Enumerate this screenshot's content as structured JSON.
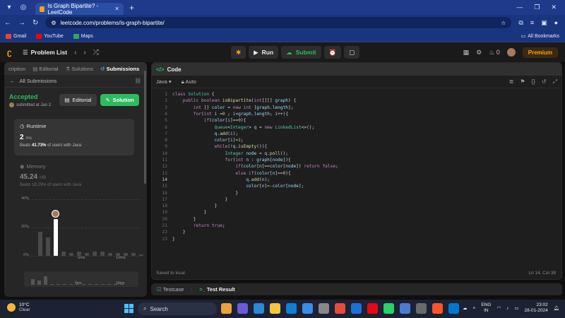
{
  "browser": {
    "tab_title": "Is Graph Bipartite? - LeetCode",
    "url": "leetcode.com/problems/is-graph-bipartite/",
    "bookmarks": [
      {
        "label": "Gmail",
        "color": "#ea4335"
      },
      {
        "label": "YouTube",
        "color": "#ff0000"
      },
      {
        "label": "Maps",
        "color": "#34a853"
      }
    ],
    "all_bookmarks": "All Bookmarks"
  },
  "lc": {
    "problem_list": "Problem List",
    "run": "Run",
    "submit": "Submit",
    "fire_count": "0",
    "premium": "Premium"
  },
  "left": {
    "tabs": [
      "cription",
      "Editorial",
      "Solutions",
      "Submissions"
    ],
    "all_submissions": "All Submissions",
    "accepted": "Accepted",
    "submitted": "submitted at Jan 2",
    "editorial_btn": "Editorial",
    "solution_btn": "Solution",
    "runtime_title": "Runtime",
    "runtime_value": "2",
    "runtime_unit": "ms",
    "runtime_beats_pre": "Beats ",
    "runtime_beats_pct": "41.73%",
    "runtime_beats_post": " of users with Java",
    "memory_title": "Memory",
    "memory_value": "45.24",
    "memory_unit": "MB",
    "memory_beats": "Beats 18.29% of users with Java",
    "hist_y": [
      "40%",
      "20%",
      "0%"
    ],
    "hist_x": [
      "5ms",
      "10ms"
    ],
    "mini_x": [
      "5ms",
      "10ms"
    ]
  },
  "hist_bars": [
    17,
    13,
    26,
    3,
    2,
    3,
    2,
    3,
    3,
    2,
    2,
    2,
    2,
    1,
    1
  ],
  "hist_highlight": 2,
  "code": {
    "panel_title": "Code",
    "language": "Java",
    "mode": "Auto",
    "saved": "Saved to local",
    "cursor": "Ln 14, Col 38",
    "current_line": 14,
    "lines": [
      "class Solution {",
      "    public boolean isBipartite(int[][] graph) {",
      "        int [] color = new int [graph.length];",
      "        for(int i =0 ; i<graph.length; i++){",
      "            if(color[i]==0){",
      "                Queue<Integer> q = new LinkedList<>();",
      "                q.add(i);",
      "                color[i]=1;",
      "                while(!q.isEmpty()){",
      "                    Integer node = q.poll();",
      "                    for(int n : graph[node]){",
      "                        if(color[n]==color[node]) return false;",
      "                        else if(color[n]==0){",
      "                            q.add(n);",
      "                            color[n]=-color[node];",
      "                        }",
      "                    }",
      "                }",
      "            }",
      "        }",
      "        return true;",
      "    }",
      "}"
    ]
  },
  "bottom": {
    "testcase": "Testcase",
    "result": "Test Result"
  },
  "taskbar": {
    "temp": "10°C",
    "weather": "Clear",
    "search": "Search",
    "lang1": "ENG",
    "lang2": "IN",
    "time": "23:02",
    "date": "28-01-2024",
    "apps": [
      "#e8a33d",
      "#6b5bd6",
      "#2b88d8",
      "#f4c542",
      "#0f7fd4",
      "#3a8ee6",
      "#888888",
      "#e44d3a",
      "#1e6fd9",
      "#e50914",
      "#25d366",
      "#4a7bd0",
      "#6a6a6a",
      "#fb542b",
      "#0078d4"
    ]
  },
  "colors": {
    "accent_green": "#2cbb5d",
    "lc_orange": "#ffa116",
    "browser_blue": "#1f3a8a"
  }
}
